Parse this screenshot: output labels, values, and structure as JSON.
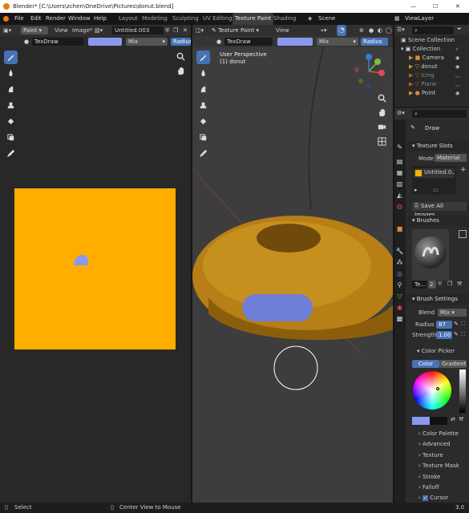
{
  "title_bar": {
    "text": "Blender* [C:\\Users\\zchen\\OneDrive\\Pictures\\donut.blend]",
    "minimize": "—",
    "maximize": "☐",
    "close": "✕"
  },
  "menu": {
    "items": [
      "File",
      "Edit",
      "Render",
      "Window",
      "Help"
    ]
  },
  "workspaces": [
    "Layout",
    "Modeling",
    "Sculpting",
    "UV Editing",
    "Texture Paint",
    "Shading"
  ],
  "active_workspace": "Texture Paint",
  "scene_name": "Scene",
  "view_layer": "ViewLayer",
  "image_editor": {
    "mode": "Paint",
    "menu_view": "View",
    "menu_image": "Image*",
    "image_name": "Untitled.003",
    "brush_name": "TexDraw",
    "blend_mode": "Mix",
    "radius_label": "Radius",
    "colors": {
      "paint_bg": "#ffae00",
      "stroke": "#8a98f0"
    }
  },
  "viewport": {
    "mode": "Texture Paint",
    "menu_view": "View",
    "brush_name": "TexDraw",
    "blend_mode": "Mix",
    "radius_label": "Radius",
    "overlay_line1": "User Perspective",
    "overlay_line2": "(1) donut"
  },
  "outliner": {
    "search_placeholder": "",
    "items": [
      {
        "label": "Scene Collection",
        "icon": "collection-icon"
      },
      {
        "label": "Collection",
        "icon": "collection-icon"
      },
      {
        "label": "Camera",
        "icon": "camera-icon"
      },
      {
        "label": "donut",
        "icon": "mesh-icon"
      },
      {
        "label": "icing",
        "icon": "mesh-icon"
      },
      {
        "label": "Plane",
        "icon": "mesh-icon"
      },
      {
        "label": "Point",
        "icon": "light-icon"
      }
    ]
  },
  "properties": {
    "tool_name": "Draw",
    "texture_slots": {
      "title": "Texture Slots",
      "mode_label": "Mode",
      "mode_value": "Material",
      "slot_name": "Untitled.0...",
      "slot_dots": ":::",
      "save_all": "Save All Images"
    },
    "brushes": {
      "title": "Brushes",
      "brush_short": "Te...",
      "users": "2"
    },
    "brush_settings": {
      "title": "Brush Settings",
      "blend_label": "Blend",
      "blend_value": "Mix",
      "radius_label": "Radius",
      "radius_value": "87 px",
      "strength_label": "Strength",
      "strength_value": "1.00"
    },
    "color_picker": {
      "title": "Color Picker",
      "tab_color": "Color",
      "tab_gradient": "Gradient"
    },
    "subpanels": [
      "Color Palette",
      "Advanced",
      "Texture",
      "Texture Mask",
      "Stroke",
      "Falloff",
      "Cursor"
    ]
  },
  "status_bar": {
    "select": "Select",
    "center": "Center View to Mouse",
    "version": "3.0"
  }
}
